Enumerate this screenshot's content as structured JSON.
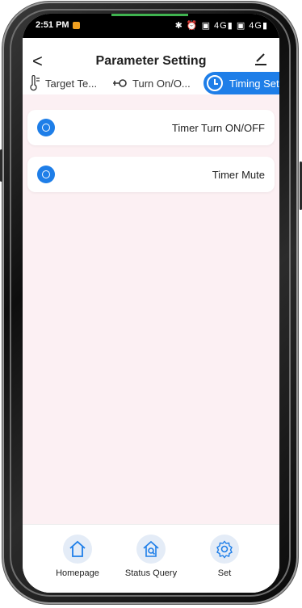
{
  "statusbar": {
    "time": "2:51 PM",
    "right_icons": "✱ ⏰ ▣ 4G▮ ▣ 4G▮"
  },
  "header": {
    "back_glyph": "<",
    "title": "Parameter Setting"
  },
  "tabs": [
    {
      "label": "Target Te...",
      "icon": "thermometer-icon"
    },
    {
      "label": "Turn On/O...",
      "icon": "key-icon"
    },
    {
      "label": "Timing Set...",
      "icon": "clock-icon",
      "active": true
    }
  ],
  "items": [
    {
      "label": "Timer Turn ON/OFF",
      "icon": "clock-icon"
    },
    {
      "label": "Timer Mute",
      "icon": "clock-icon"
    }
  ],
  "bottom_nav": [
    {
      "label": "Homepage",
      "icon": "home-icon"
    },
    {
      "label": "Status Query",
      "icon": "status-query-icon"
    },
    {
      "label": "Set",
      "icon": "gear-icon"
    }
  ],
  "colors": {
    "accent": "#1e7ee8",
    "content_bg": "#fcf0f3",
    "nav_bubble": "#e4ecf7"
  }
}
